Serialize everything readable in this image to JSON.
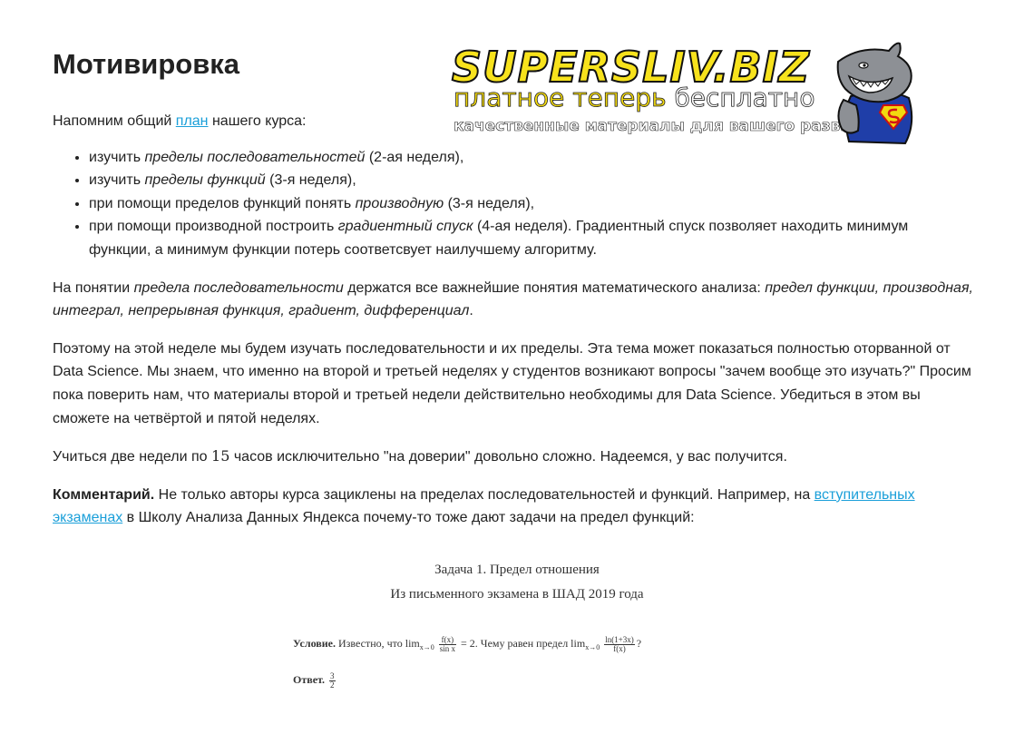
{
  "page": {
    "title": "Мотивировка",
    "intro": {
      "before": "Напомним общий ",
      "link": "план",
      "after": " нашего курса:"
    },
    "plan_items": [
      {
        "pre": "изучить ",
        "em": "пределы последовательностей",
        "post": " (2-ая неделя),"
      },
      {
        "pre": "изучить ",
        "em": "пределы функций",
        "post": " (3-я неделя),"
      },
      {
        "pre": "при помощи пределов функций понять ",
        "em": "производную",
        "post": " (3-я неделя),"
      },
      {
        "pre": "при помощи производной построить ",
        "em": "градиентный спуск",
        "post": " (4-ая неделя). Градиентный спуск позволяет находить минимум функции, а минимум функции потерь соответсвует наилучшему алгоритму."
      }
    ],
    "para_concept": {
      "pre": "На понятии ",
      "em1": "предела последовательности",
      "mid": " держатся все важнейшие понятия математического анализа: ",
      "em2": "предел функции, производная, интеграл, непрерывная функция, градиент, дифференциал",
      "post": "."
    },
    "para_why": "Поэтому на этой неделе мы будем изучать последовательности и их пределы. Эта тема может показаться полностью оторванной от Data Science. Мы знаем, что именно на второй и третьей неделях у студентов возникают вопросы \"зачем вообще это изучать?\" Просим пока поверить нам, что материалы второй и третьей недели действительно необходимы для Data Science. Убедиться в этом вы сможете на четвёртой и пятой неделях.",
    "para_trust": {
      "pre": "Учиться две недели по ",
      "num": "15",
      "post": " часов исключительно \"на доверии\" довольно сложно. Надеемся, у вас получится."
    },
    "para_comment": {
      "bold": "Комментарий.",
      "pre": " Не только авторы курса зациклены на пределах последовательностей и функций. Например, на ",
      "link": "вступительных экзаменах",
      "post": " в Школу Анализа Данных Яндекса почему-то тоже дают задачи на предел функций:"
    }
  },
  "logo": {
    "title": "SUPERSLIV.BIZ",
    "sub_a": "платное теперь",
    "sub_b": " бесплатно",
    "tagline": "качественные материалы для вашего развития",
    "icon": "shark-superhero-icon"
  },
  "exam": {
    "title": "Задача 1. Предел отношения",
    "subtitle": "Из письменного экзамена в ШАД 2019 года",
    "cond_label": "Условие.",
    "cond_a": " Известно, что lim",
    "cond_a_sub": "x→0",
    "frac1_num": "f(x)",
    "frac1_den": "sin x",
    "cond_b": " = 2. Чему равен предел lim",
    "cond_b_sub": "x→0",
    "frac2_num": "ln(1+3x)",
    "frac2_den": "f(x)",
    "cond_c": "?",
    "ans_label": "Ответ.",
    "ans_num": "3",
    "ans_den": "2"
  },
  "colors": {
    "link": "#1a9fd9",
    "logo_yellow": "#f7e21c",
    "text": "#222222"
  }
}
